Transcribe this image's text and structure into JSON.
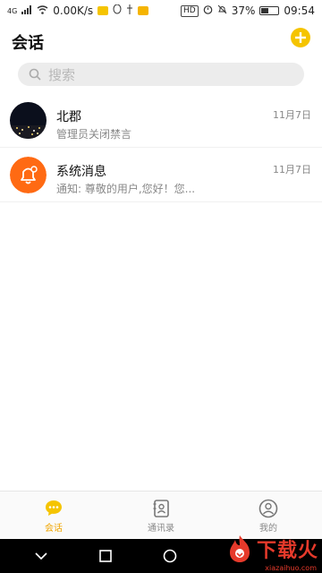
{
  "status_bar": {
    "network": "4G",
    "speed": "0.00K/s",
    "hd_badge": "HD",
    "battery": "37%",
    "time": "09:54"
  },
  "header": {
    "title": "会话",
    "add_icon": "plus-circle-icon"
  },
  "search": {
    "placeholder": "搜索",
    "icon": "search-icon"
  },
  "conversations": [
    {
      "name": "北郡",
      "preview": "管理员关闭禁言",
      "time": "11月7日",
      "avatar": "night-city-photo"
    },
    {
      "name": "系统消息",
      "preview": "通知: 尊敬的用户,您好！您...",
      "time": "11月7日",
      "avatar": "bell-icon"
    }
  ],
  "bottom_nav": [
    {
      "label": "会话",
      "icon": "chat-bubble-icon",
      "active": true
    },
    {
      "label": "通讯录",
      "icon": "contacts-book-icon",
      "active": false
    },
    {
      "label": "我的",
      "icon": "user-icon",
      "active": false
    }
  ],
  "watermark": {
    "text": "下载火",
    "sub": "xiazaihuo.com"
  },
  "colors": {
    "accent": "#f0a500",
    "system_bell": "#ff6a13"
  }
}
